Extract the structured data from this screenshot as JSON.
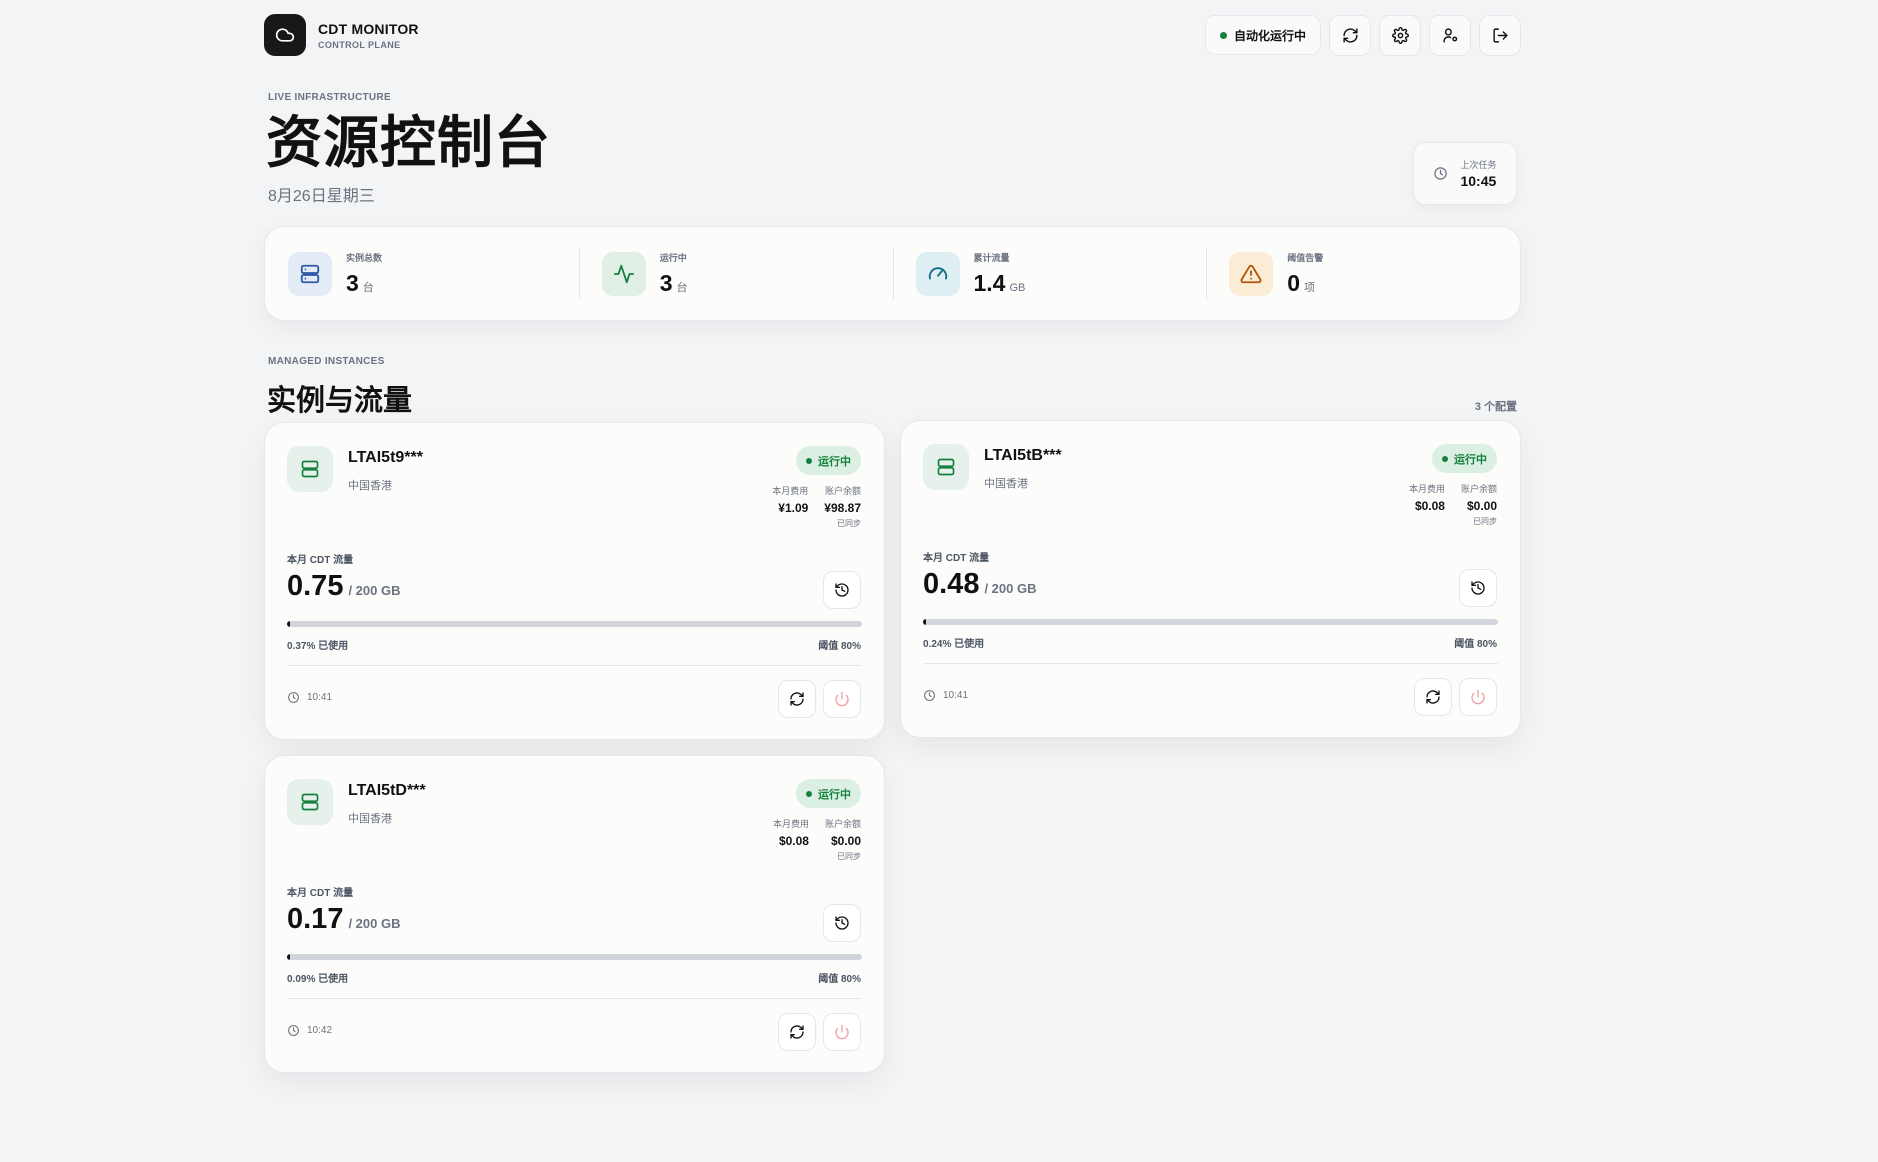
{
  "brand": {
    "title": "CDT MONITOR",
    "subtitle": "CONTROL PLANE"
  },
  "header": {
    "status_label": "自动化运行中"
  },
  "hero": {
    "eyebrow": "LIVE INFRASTRUCTURE",
    "title": "资源控制台",
    "date": "8月26日星期三"
  },
  "last_task": {
    "label": "上次任务",
    "value": "10:45"
  },
  "stats": [
    {
      "label": "实例总数",
      "value": "3",
      "unit": "台",
      "icon": "server-icon"
    },
    {
      "label": "运行中",
      "value": "3",
      "unit": "台",
      "icon": "activity-icon"
    },
    {
      "label": "累计流量",
      "value": "1.4",
      "unit": "GB",
      "icon": "gauge-icon"
    },
    {
      "label": "阈值告警",
      "value": "0",
      "unit": "项",
      "icon": "alert-triangle-icon"
    }
  ],
  "section": {
    "eyebrow": "MANAGED INSTANCES",
    "title": "实例与流量",
    "count": "3 个配置"
  },
  "instances": [
    {
      "name": "LTAI5t9***",
      "region": "中国香港",
      "status": "运行中",
      "fee_label": "本月费用",
      "fee": "¥1.09",
      "balance_label": "账户余额",
      "balance": "¥98.87",
      "sync": "已同步",
      "traffic_label": "本月 CDT 流量",
      "traffic": "0.75",
      "cap": "/ 200 GB",
      "usage_fraction": 0.0037,
      "used": "0.37% 已使用",
      "threshold": "阈值 80%",
      "time": "10:41"
    },
    {
      "name": "LTAI5tB***",
      "region": "中国香港",
      "status": "运行中",
      "fee_label": "本月费用",
      "fee": "$0.08",
      "balance_label": "账户余额",
      "balance": "$0.00",
      "sync": "已同步",
      "traffic_label": "本月 CDT 流量",
      "traffic": "0.48",
      "cap": "/ 200 GB",
      "usage_fraction": 0.0024,
      "used": "0.24% 已使用",
      "threshold": "阈值 80%",
      "time": "10:41"
    },
    {
      "name": "LTAI5tD***",
      "region": "中国香港",
      "status": "运行中",
      "fee_label": "本月费用",
      "fee": "$0.08",
      "balance_label": "账户余额",
      "balance": "$0.00",
      "sync": "已同步",
      "traffic_label": "本月 CDT 流量",
      "traffic": "0.17",
      "cap": "/ 200 GB",
      "usage_fraction": 0.0009,
      "used": "0.09% 已使用",
      "threshold": "阈值 80%",
      "time": "10:42"
    }
  ],
  "colors": {
    "accent_dark": "#18181b",
    "status_green": "#15803d",
    "warn_amber": "#b45309",
    "danger_soft": "#f5a3a3"
  }
}
